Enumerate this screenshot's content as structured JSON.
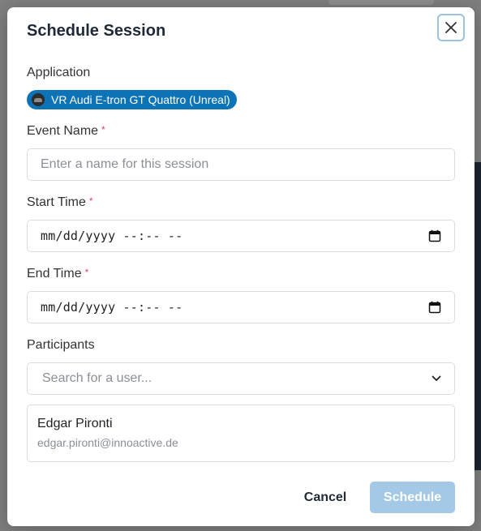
{
  "modal": {
    "title": "Schedule Session",
    "close_icon": "close-icon"
  },
  "application": {
    "label": "Application",
    "selected_app": "VR Audi E-tron GT Quattro (Unreal)",
    "icon": "app-thumbnail-icon",
    "pill_color": "#0d73b7"
  },
  "event_name": {
    "label": "Event Name",
    "required_mark": "*",
    "value": "",
    "placeholder": "Enter a name for this session"
  },
  "start_time": {
    "label": "Start Time",
    "required_mark": "*",
    "value_display": "mm/dd/yyyy --:-- --",
    "icon": "calendar-icon"
  },
  "end_time": {
    "label": "End Time",
    "required_mark": "*",
    "value_display": "mm/dd/yyyy --:-- --",
    "icon": "calendar-icon"
  },
  "participants": {
    "label": "Participants",
    "search_placeholder": "Search for a user...",
    "dropdown_icon": "chevron-down-icon",
    "list": [
      {
        "name": "Edgar Pironti",
        "email": "edgar.pironti@innoactive.de"
      }
    ]
  },
  "actions": {
    "cancel_label": "Cancel",
    "schedule_label": "Schedule",
    "schedule_color": "#a3c9e6",
    "required_color": "#e0436a"
  }
}
